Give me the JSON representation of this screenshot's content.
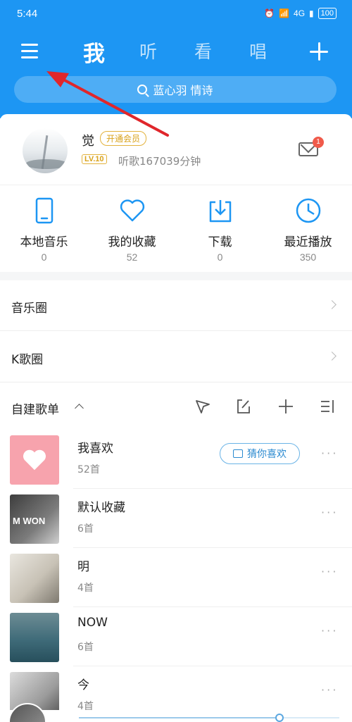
{
  "status_bar": {
    "time": "5:44",
    "network_label": "4G",
    "battery": "100"
  },
  "tabs": [
    {
      "label": "我",
      "active": true
    },
    {
      "label": "听",
      "active": false
    },
    {
      "label": "看",
      "active": false
    },
    {
      "label": "唱",
      "active": false
    }
  ],
  "search": {
    "placeholder": "蓝心羽 情诗"
  },
  "profile": {
    "name": "觉",
    "vip_label": "开通会员",
    "level": "LV.10",
    "listen_time": "听歌167039分钟",
    "mail_badge": "1"
  },
  "quick_actions": [
    {
      "label": "本地音乐",
      "count": "0",
      "icon": "phone-icon"
    },
    {
      "label": "我的收藏",
      "count": "52",
      "icon": "heart-icon"
    },
    {
      "label": "下载",
      "count": "0",
      "icon": "download-icon"
    },
    {
      "label": "最近播放",
      "count": "350",
      "icon": "clock-icon"
    }
  ],
  "links": [
    {
      "label": "音乐圈"
    },
    {
      "label": "K歌圈"
    }
  ],
  "playlists_section": {
    "title": "自建歌单"
  },
  "playlists": [
    {
      "name": "我喜欢",
      "count": "52首",
      "cover_text": ""
    },
    {
      "name": "默认收藏",
      "count": "6首",
      "cover_text": "M WON"
    },
    {
      "name": "明",
      "count": "4首",
      "cover_text": ""
    },
    {
      "name": "NOW",
      "count": "6首",
      "cover_text": ""
    },
    {
      "name": "今",
      "count": "4首",
      "cover_text": ""
    }
  ],
  "guess_button": {
    "label": "猜你喜欢"
  },
  "player": {
    "progress": 0.77
  },
  "colors": {
    "header_blue": "#1d96f3",
    "vip_gold": "#e3b23c",
    "accent_blue": "#2b8ad0",
    "annotation_red": "#e0262b"
  }
}
